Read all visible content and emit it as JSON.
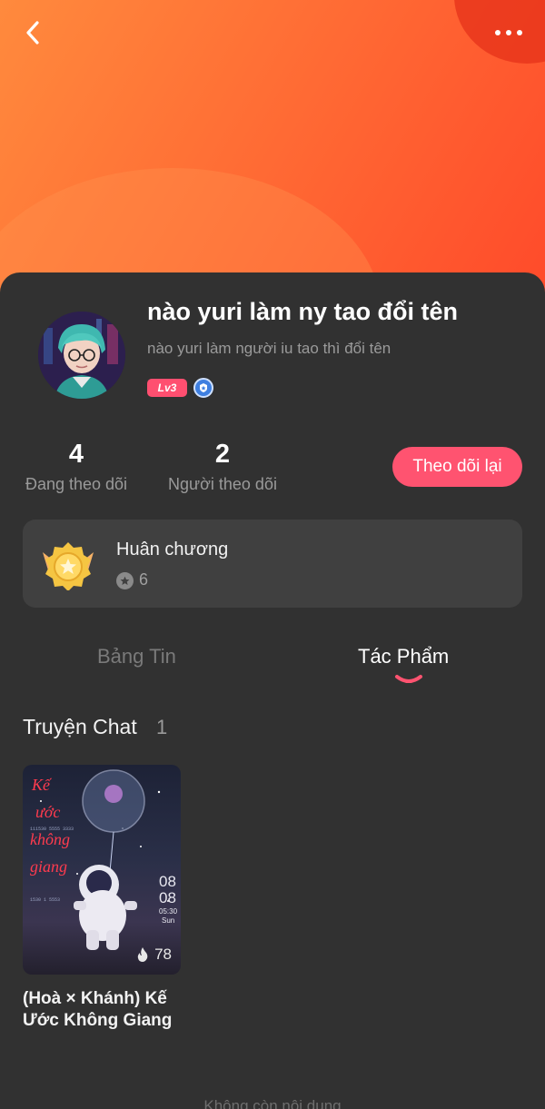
{
  "profile": {
    "name": "nào yuri làm ny tao đổi tên",
    "bio": "nào yuri làm người iu tao thì đổi tên",
    "level": "Lv3",
    "following_count": "4",
    "following_label": "Đang theo dõi",
    "followers_count": "2",
    "followers_label": "Người theo dõi",
    "follow_back_label": "Theo dõi lại"
  },
  "medals": {
    "title": "Huân chương",
    "count": "6"
  },
  "tabs": [
    {
      "label": "Bảng Tin",
      "active": false
    },
    {
      "label": "Tác Phẩm",
      "active": true
    }
  ],
  "section": {
    "title": "Truyện Chat",
    "count": "1"
  },
  "stories": [
    {
      "title": "(Hoà × Khánh) Kế Ước Không Giang",
      "views": "78",
      "cover_text": {
        "title_lines": [
          "Kế",
          "ước",
          "không",
          "giang"
        ],
        "clock_1": "08",
        "clock_2": "08",
        "time": "05:30",
        "day": "Sun"
      }
    }
  ],
  "footer_hint": "Không còn nội dung",
  "icons": {
    "back": "chevron-left-icon",
    "more": "more-dots-icon",
    "shield": "shield-badge-icon",
    "medal": "medal-icon",
    "star": "star-circle-icon",
    "fire": "flame-icon"
  },
  "colors": {
    "accent": "#ff5370",
    "header_gradient_start": "#ff8a3d",
    "header_gradient_end": "#ff4a2a",
    "background": "#313131",
    "card": "#404040"
  }
}
